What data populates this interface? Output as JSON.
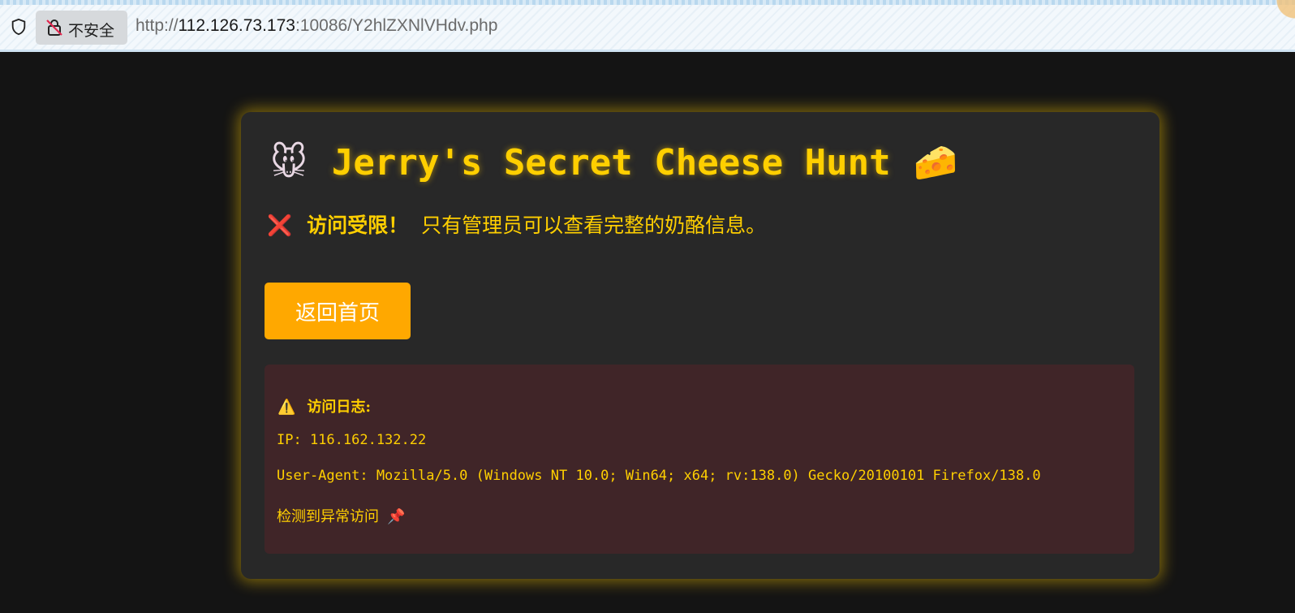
{
  "browser": {
    "security_label": "不安全",
    "url_prefix": "http://",
    "url_host": "112.126.73.173",
    "url_path": ":10086/Y2hlZXNlVHdv.php"
  },
  "page": {
    "title_emoji_left": "🐭",
    "title": "Jerry's Secret Cheese Hunt",
    "title_emoji_right": "🧀",
    "denied_icon": "❌",
    "denied_strong": "访问受限！",
    "denied_text": "只有管理员可以查看完整的奶酪信息。",
    "home_button": "返回首页"
  },
  "log": {
    "warning_icon": "⚠️",
    "title": "访问日志:",
    "ip_line": "IP: 116.162.132.22",
    "ua_line": "User-Agent: Mozilla/5.0 (Windows NT 10.0; Win64; x64; rv:138.0) Gecko/20100101 Firefox/138.0",
    "note": "检测到异常访问",
    "note_icon": "📌"
  },
  "colors": {
    "accent_yellow": "#ffcf00",
    "button_orange": "#ffa800",
    "page_bg": "#141414",
    "card_bg": "#282828",
    "log_bg": "#402528"
  }
}
